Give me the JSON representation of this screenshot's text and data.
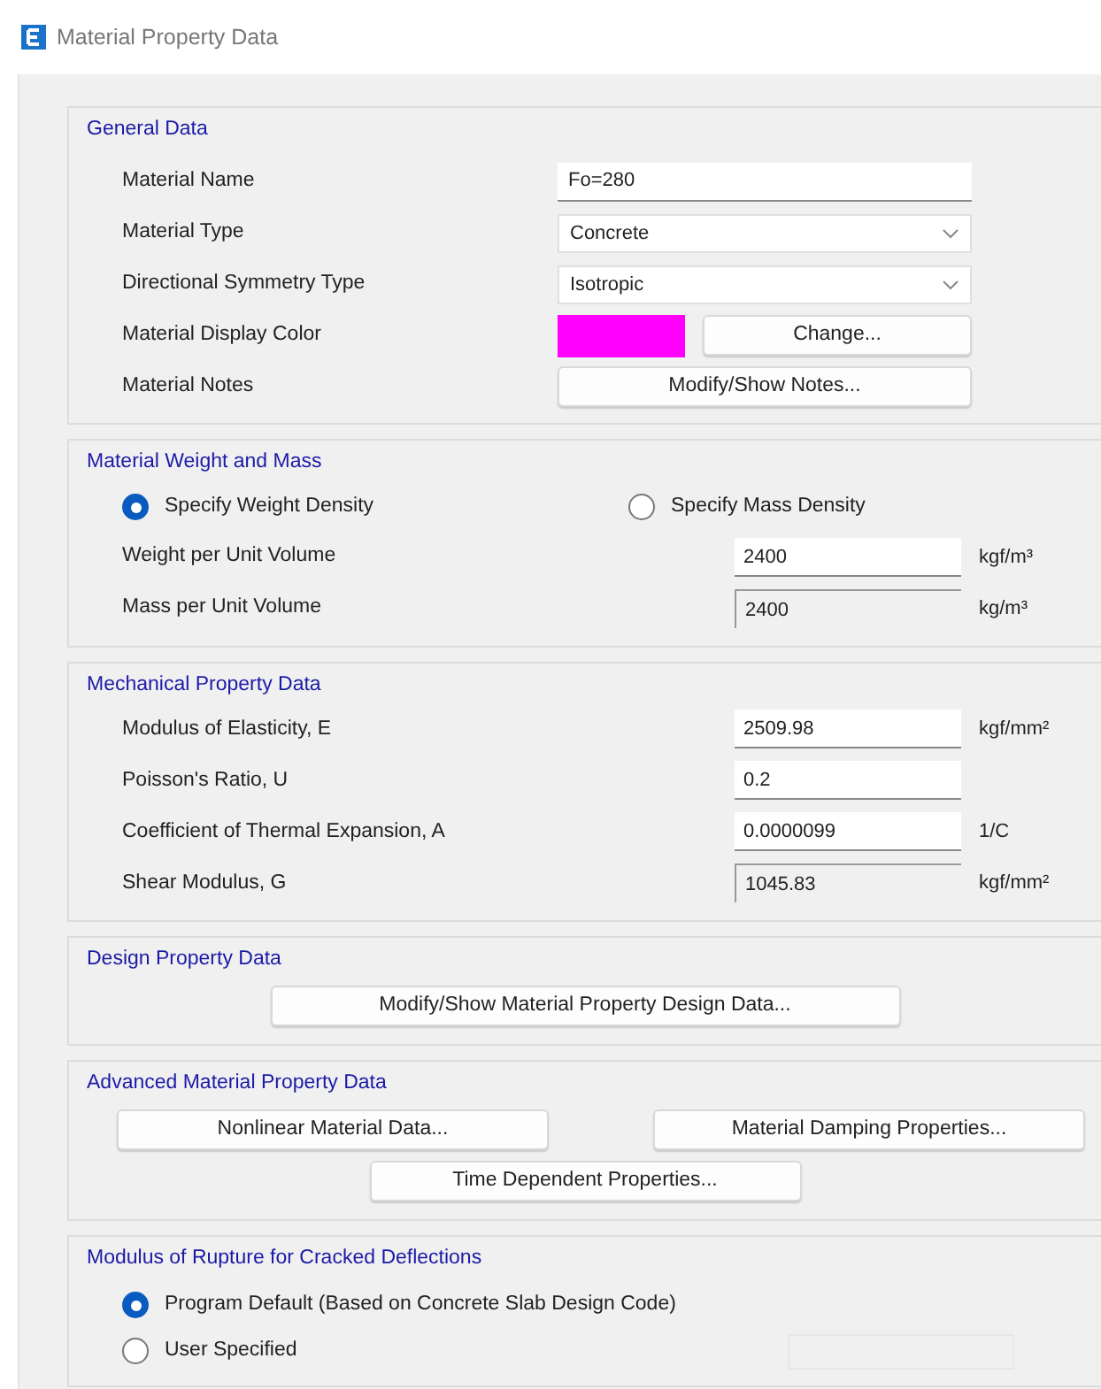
{
  "window": {
    "title": "Material Property Data"
  },
  "sections": [
    {
      "kind": "form",
      "title": "General Data",
      "rows": [
        {
          "kind": "text",
          "label": "Material Name",
          "value": "Fo=280"
        },
        {
          "kind": "select",
          "label": "Material Type",
          "value": "Concrete"
        },
        {
          "kind": "select",
          "label": "Directional Symmetry Type",
          "value": "Isotropic"
        },
        {
          "kind": "color",
          "label": "Material Display Color",
          "color": "#ff00ff",
          "button": "Change..."
        },
        {
          "kind": "button",
          "label": "Material Notes",
          "button": "Modify/Show Notes..."
        }
      ]
    },
    {
      "kind": "numeric",
      "title": "Material Weight and Mass",
      "radios": [
        {
          "label": "Specify Weight Density",
          "selected": true
        },
        {
          "label": "Specify Mass Density",
          "selected": false
        }
      ],
      "rows": [
        {
          "label": "Weight per Unit Volume",
          "value": "2400",
          "unit": "kgf/m³",
          "disabled": false
        },
        {
          "label": "Mass per Unit Volume",
          "value": "2400",
          "unit": "kg/m³",
          "disabled": true
        }
      ]
    },
    {
      "kind": "numeric",
      "title": "Mechanical Property Data",
      "rows": [
        {
          "label": "Modulus of Elasticity,  E",
          "value": "2509.98",
          "unit": "kgf/mm²",
          "disabled": false
        },
        {
          "label": "Poisson's Ratio,  U",
          "value": "0.2",
          "disabled": false
        },
        {
          "label": "Coefficient of Thermal Expansion,  A",
          "value": "0.0000099",
          "unit": "1/C",
          "disabled": false
        },
        {
          "label": "Shear Modulus,  G",
          "value": "1045.83",
          "unit": "kgf/mm²",
          "disabled": true
        }
      ]
    },
    {
      "kind": "buttons",
      "title": "Design Property Data",
      "buttons": [
        [
          "Modify/Show Material Property Design Data..."
        ]
      ]
    },
    {
      "kind": "buttons",
      "title": "Advanced Material Property Data",
      "buttons": [
        [
          "Nonlinear Material Data...",
          "Material Damping Properties..."
        ],
        [
          "Time Dependent Properties..."
        ]
      ]
    },
    {
      "kind": "radiolist",
      "title": "Modulus of Rupture for Cracked Deflections",
      "radios": [
        {
          "label": "Program Default  (Based on Concrete Slab Design Code)",
          "selected": true
        },
        {
          "label": "User Specified",
          "selected": false,
          "field": true
        }
      ]
    }
  ]
}
